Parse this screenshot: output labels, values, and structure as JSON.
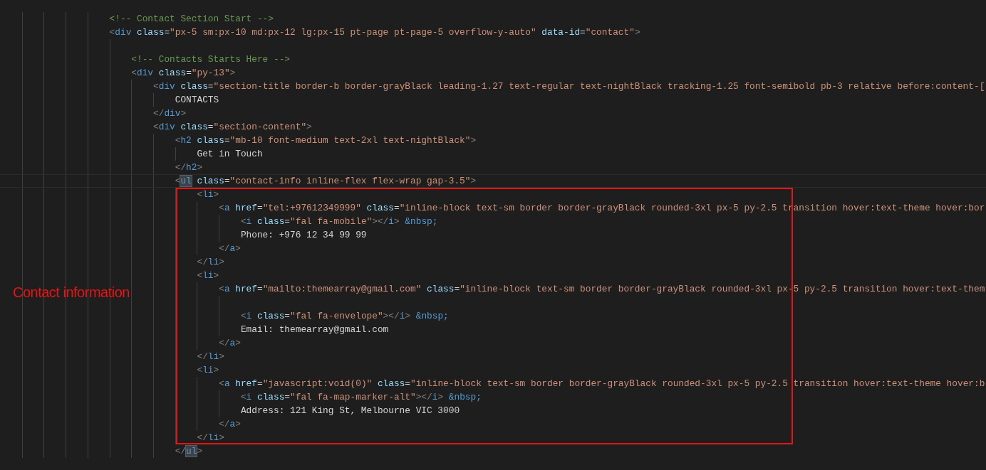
{
  "code": [
    {
      "kind": "code",
      "tokens": [
        {
          "kind": "comment",
          "text": "<!-- Contact Section Start -->"
        }
      ]
    },
    {
      "kind": "code",
      "tokens": [
        {
          "kind": "punct",
          "text": "<"
        },
        {
          "kind": "tag",
          "text": "div"
        },
        {
          "kind": "attr",
          "text": " class"
        },
        {
          "kind": "op",
          "text": "="
        },
        {
          "kind": "string",
          "text": "\"px-5 sm:px-10 md:px-12 lg:px-15 pt-page pt-page-5 overflow-y-auto\""
        },
        {
          "kind": "attr",
          "text": " data-id"
        },
        {
          "kind": "op",
          "text": "="
        },
        {
          "kind": "string",
          "text": "\"contact\""
        },
        {
          "kind": "punct",
          "text": ">"
        }
      ],
      "children": [
        {
          "kind": "blank"
        },
        {
          "kind": "code",
          "tokens": [
            {
              "kind": "comment",
              "text": "<!-- Contacts Starts Here -->"
            }
          ]
        },
        {
          "kind": "code",
          "tokens": [
            {
              "kind": "punct",
              "text": "<"
            },
            {
              "kind": "tag",
              "text": "div"
            },
            {
              "kind": "attr",
              "text": " class"
            },
            {
              "kind": "op",
              "text": "="
            },
            {
              "kind": "string",
              "text": "\"py-13\""
            },
            {
              "kind": "punct",
              "text": ">"
            }
          ],
          "children": [
            {
              "kind": "code",
              "tokens": [
                {
                  "kind": "punct",
                  "text": "<"
                },
                {
                  "kind": "tag",
                  "text": "div"
                },
                {
                  "kind": "attr",
                  "text": " class"
                },
                {
                  "kind": "op",
                  "text": "="
                },
                {
                  "kind": "string",
                  "text": "\"section-title border-b border-grayBlack leading-1.27 text-regular text-nightBlack tracking-1.25 font-semibold pb-3 relative before:content-["
                }
              ],
              "children": [
                {
                  "kind": "code",
                  "tokens": [
                    {
                      "kind": "text",
                      "text": "CONTACTS"
                    }
                  ]
                }
              ]
            },
            {
              "kind": "code",
              "tokens": [
                {
                  "kind": "punct",
                  "text": "</"
                },
                {
                  "kind": "tag",
                  "text": "div"
                },
                {
                  "kind": "punct",
                  "text": ">"
                }
              ]
            },
            {
              "kind": "code",
              "tokens": [
                {
                  "kind": "punct",
                  "text": "<"
                },
                {
                  "kind": "tag",
                  "text": "div"
                },
                {
                  "kind": "attr",
                  "text": " class"
                },
                {
                  "kind": "op",
                  "text": "="
                },
                {
                  "kind": "string",
                  "text": "\"section-content\""
                },
                {
                  "kind": "punct",
                  "text": ">"
                }
              ],
              "children": [
                {
                  "kind": "code",
                  "tokens": [
                    {
                      "kind": "punct",
                      "text": "<"
                    },
                    {
                      "kind": "tag",
                      "text": "h2"
                    },
                    {
                      "kind": "attr",
                      "text": " class"
                    },
                    {
                      "kind": "op",
                      "text": "="
                    },
                    {
                      "kind": "string",
                      "text": "\"mb-10 font-medium text-2xl text-nightBlack\""
                    },
                    {
                      "kind": "punct",
                      "text": ">"
                    }
                  ],
                  "children": [
                    {
                      "kind": "code",
                      "tokens": [
                        {
                          "kind": "text",
                          "text": "Get in Touch"
                        }
                      ]
                    }
                  ]
                },
                {
                  "kind": "code",
                  "tokens": [
                    {
                      "kind": "punct",
                      "text": "</"
                    },
                    {
                      "kind": "tag",
                      "text": "h2"
                    },
                    {
                      "kind": "punct",
                      "text": ">"
                    }
                  ]
                },
                {
                  "kind": "code",
                  "current": true,
                  "tokens": [
                    {
                      "kind": "punct",
                      "text": "<"
                    },
                    {
                      "kind": "tag",
                      "text": "ul",
                      "matched": true
                    },
                    {
                      "kind": "attr",
                      "text": " class"
                    },
                    {
                      "kind": "op",
                      "text": "="
                    },
                    {
                      "kind": "string",
                      "text": "\"contact-info inline-flex flex-wrap gap-3.5\""
                    },
                    {
                      "kind": "punct",
                      "text": ">"
                    }
                  ],
                  "children": [
                    {
                      "kind": "code",
                      "tokens": [
                        {
                          "kind": "punct",
                          "text": "<"
                        },
                        {
                          "kind": "tag",
                          "text": "li"
                        },
                        {
                          "kind": "punct",
                          "text": ">"
                        }
                      ],
                      "children": [
                        {
                          "kind": "code",
                          "tokens": [
                            {
                              "kind": "punct",
                              "text": "<"
                            },
                            {
                              "kind": "tag",
                              "text": "a"
                            },
                            {
                              "kind": "attr",
                              "text": " href"
                            },
                            {
                              "kind": "op",
                              "text": "="
                            },
                            {
                              "kind": "string",
                              "text": "\"tel:+97612349999\""
                            },
                            {
                              "kind": "attr",
                              "text": " class"
                            },
                            {
                              "kind": "op",
                              "text": "="
                            },
                            {
                              "kind": "string",
                              "text": "\"inline-block text-sm border border-grayBlack rounded-3xl px-5 py-2.5 transition hover:text-theme hover:bor"
                            }
                          ],
                          "children": [
                            {
                              "kind": "code",
                              "tokens": [
                                {
                                  "kind": "punct",
                                  "text": "<"
                                },
                                {
                                  "kind": "tag",
                                  "text": "i"
                                },
                                {
                                  "kind": "attr",
                                  "text": " class"
                                },
                                {
                                  "kind": "op",
                                  "text": "="
                                },
                                {
                                  "kind": "string",
                                  "text": "\"fal fa-mobile\""
                                },
                                {
                                  "kind": "punct",
                                  "text": "></"
                                },
                                {
                                  "kind": "tag",
                                  "text": "i"
                                },
                                {
                                  "kind": "punct",
                                  "text": ">"
                                },
                                {
                                  "kind": "entity",
                                  "text": " &nbsp;"
                                }
                              ]
                            },
                            {
                              "kind": "code",
                              "tokens": [
                                {
                                  "kind": "text",
                                  "text": "Phone: +976 12 34 99 99"
                                }
                              ]
                            }
                          ]
                        },
                        {
                          "kind": "code",
                          "tokens": [
                            {
                              "kind": "punct",
                              "text": "</"
                            },
                            {
                              "kind": "tag",
                              "text": "a"
                            },
                            {
                              "kind": "punct",
                              "text": ">"
                            }
                          ]
                        }
                      ]
                    },
                    {
                      "kind": "code",
                      "tokens": [
                        {
                          "kind": "punct",
                          "text": "</"
                        },
                        {
                          "kind": "tag",
                          "text": "li"
                        },
                        {
                          "kind": "punct",
                          "text": ">"
                        }
                      ]
                    },
                    {
                      "kind": "code",
                      "tokens": [
                        {
                          "kind": "punct",
                          "text": "<"
                        },
                        {
                          "kind": "tag",
                          "text": "li"
                        },
                        {
                          "kind": "punct",
                          "text": ">"
                        }
                      ],
                      "children": [
                        {
                          "kind": "code",
                          "tokens": [
                            {
                              "kind": "punct",
                              "text": "<"
                            },
                            {
                              "kind": "tag",
                              "text": "a"
                            },
                            {
                              "kind": "attr",
                              "text": " href"
                            },
                            {
                              "kind": "op",
                              "text": "="
                            },
                            {
                              "kind": "string",
                              "text": "\"mailto:themearray@gmail.com\""
                            },
                            {
                              "kind": "attr",
                              "text": " class"
                            },
                            {
                              "kind": "op",
                              "text": "="
                            },
                            {
                              "kind": "string",
                              "text": "\"inline-block text-sm border border-grayBlack rounded-3xl px-5 py-2.5 transition hover:text-them"
                            }
                          ],
                          "children": [
                            {
                              "kind": "blank"
                            },
                            {
                              "kind": "code",
                              "tokens": [
                                {
                                  "kind": "punct",
                                  "text": "<"
                                },
                                {
                                  "kind": "tag",
                                  "text": "i"
                                },
                                {
                                  "kind": "attr",
                                  "text": " class"
                                },
                                {
                                  "kind": "op",
                                  "text": "="
                                },
                                {
                                  "kind": "string",
                                  "text": "\"fal fa-envelope\""
                                },
                                {
                                  "kind": "punct",
                                  "text": "></"
                                },
                                {
                                  "kind": "tag",
                                  "text": "i"
                                },
                                {
                                  "kind": "punct",
                                  "text": ">"
                                },
                                {
                                  "kind": "entity",
                                  "text": " &nbsp;"
                                }
                              ]
                            },
                            {
                              "kind": "code",
                              "tokens": [
                                {
                                  "kind": "text",
                                  "text": "Email: themearray@gmail.com"
                                }
                              ]
                            }
                          ]
                        },
                        {
                          "kind": "code",
                          "tokens": [
                            {
                              "kind": "punct",
                              "text": "</"
                            },
                            {
                              "kind": "tag",
                              "text": "a"
                            },
                            {
                              "kind": "punct",
                              "text": ">"
                            }
                          ]
                        }
                      ]
                    },
                    {
                      "kind": "code",
                      "tokens": [
                        {
                          "kind": "punct",
                          "text": "</"
                        },
                        {
                          "kind": "tag",
                          "text": "li"
                        },
                        {
                          "kind": "punct",
                          "text": ">"
                        }
                      ]
                    },
                    {
                      "kind": "code",
                      "tokens": [
                        {
                          "kind": "punct",
                          "text": "<"
                        },
                        {
                          "kind": "tag",
                          "text": "li"
                        },
                        {
                          "kind": "punct",
                          "text": ">"
                        }
                      ],
                      "children": [
                        {
                          "kind": "code",
                          "tokens": [
                            {
                              "kind": "punct",
                              "text": "<"
                            },
                            {
                              "kind": "tag",
                              "text": "a"
                            },
                            {
                              "kind": "attr",
                              "text": " href"
                            },
                            {
                              "kind": "op",
                              "text": "="
                            },
                            {
                              "kind": "string",
                              "text": "\"javascript:void(0)\""
                            },
                            {
                              "kind": "attr",
                              "text": " class"
                            },
                            {
                              "kind": "op",
                              "text": "="
                            },
                            {
                              "kind": "string",
                              "text": "\"inline-block text-sm border border-grayBlack rounded-3xl px-5 py-2.5 transition hover:text-theme hover:b"
                            }
                          ],
                          "children": [
                            {
                              "kind": "code",
                              "tokens": [
                                {
                                  "kind": "punct",
                                  "text": "<"
                                },
                                {
                                  "kind": "tag",
                                  "text": "i"
                                },
                                {
                                  "kind": "attr",
                                  "text": " class"
                                },
                                {
                                  "kind": "op",
                                  "text": "="
                                },
                                {
                                  "kind": "string",
                                  "text": "\"fal fa-map-marker-alt\""
                                },
                                {
                                  "kind": "punct",
                                  "text": "></"
                                },
                                {
                                  "kind": "tag",
                                  "text": "i"
                                },
                                {
                                  "kind": "punct",
                                  "text": ">"
                                },
                                {
                                  "kind": "entity",
                                  "text": " &nbsp;"
                                }
                              ]
                            },
                            {
                              "kind": "code",
                              "tokens": [
                                {
                                  "kind": "text",
                                  "text": "Address: 121 King St, Melbourne VIC 3000"
                                }
                              ]
                            }
                          ]
                        },
                        {
                          "kind": "code",
                          "tokens": [
                            {
                              "kind": "punct",
                              "text": "</"
                            },
                            {
                              "kind": "tag",
                              "text": "a"
                            },
                            {
                              "kind": "punct",
                              "text": ">"
                            }
                          ]
                        }
                      ]
                    },
                    {
                      "kind": "code",
                      "tokens": [
                        {
                          "kind": "punct",
                          "text": "</"
                        },
                        {
                          "kind": "tag",
                          "text": "li"
                        },
                        {
                          "kind": "punct",
                          "text": ">"
                        }
                      ]
                    }
                  ]
                },
                {
                  "kind": "code",
                  "tokens": [
                    {
                      "kind": "punct",
                      "text": "</"
                    },
                    {
                      "kind": "tag",
                      "text": "ul",
                      "matched": true
                    },
                    {
                      "kind": "punct",
                      "text": ">"
                    }
                  ]
                }
              ]
            }
          ]
        }
      ]
    }
  ],
  "annotation": {
    "label": "Contact information"
  }
}
